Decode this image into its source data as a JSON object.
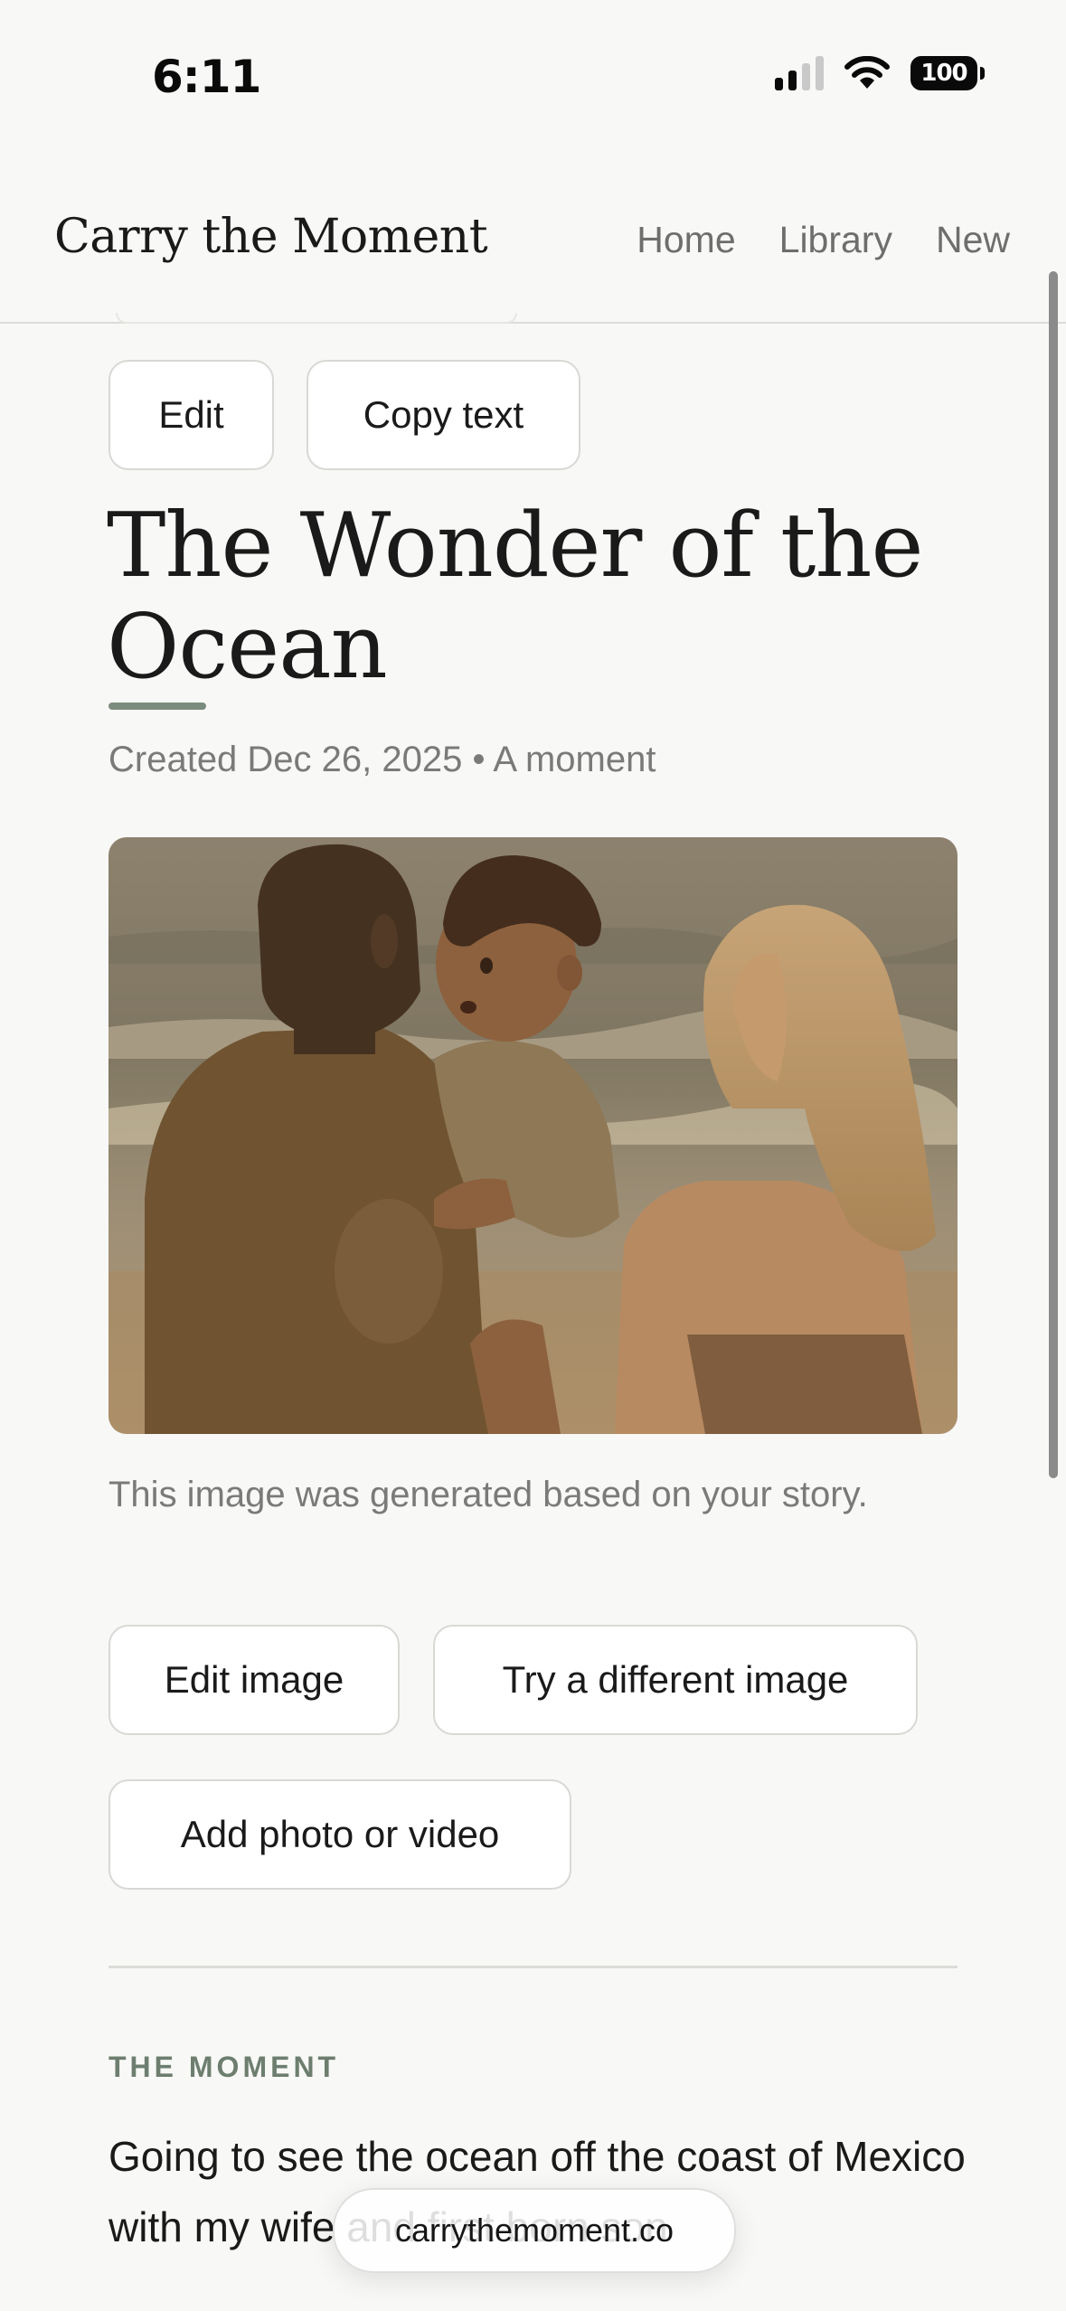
{
  "status_bar": {
    "time": "6:11",
    "battery": "100",
    "icons": [
      "signal-icon",
      "wifi-icon",
      "battery-icon"
    ]
  },
  "header": {
    "brand": "Carry the Moment",
    "nav": [
      "Home",
      "Library",
      "New"
    ]
  },
  "actions": {
    "edit": "Edit",
    "copy_text": "Copy text"
  },
  "story": {
    "title": "The Wonder of the Ocean",
    "meta": "Created Dec 26, 2025 • A moment",
    "image_note": "This image was generated based on your story.",
    "image_actions": {
      "edit_image": "Edit image",
      "try_different": "Try a different image",
      "add_media": "Add photo or video"
    },
    "section_label": "THE MOMENT",
    "moment_text": "Going to see the ocean off the coast of Mexico with my wife and first born son"
  },
  "browser": {
    "url": "carrythemoment.co"
  },
  "colors": {
    "background": "#f8f8f6",
    "accent": "#7a8c7d",
    "label": "#6d7e6f",
    "muted_text": "#7a7a7a"
  }
}
